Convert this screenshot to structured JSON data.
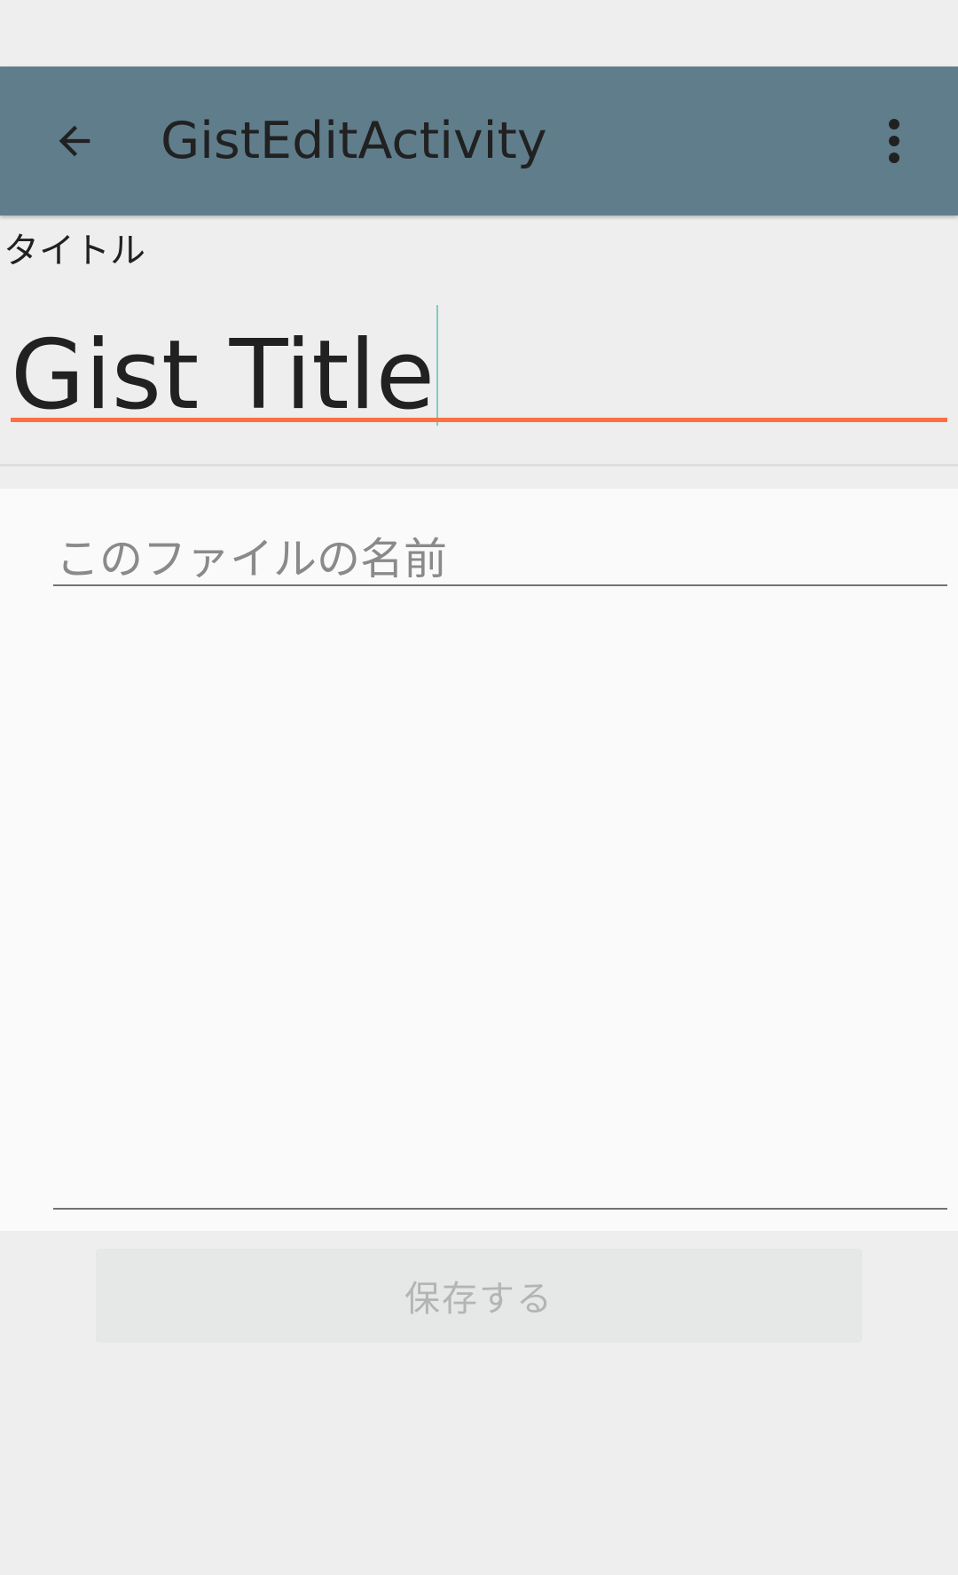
{
  "toolbar": {
    "title": "GistEditActivity",
    "back_icon": "arrow-back-icon",
    "overflow_icon": "more-vert-icon",
    "background_color": "#607d8b"
  },
  "form": {
    "title_label": "タイトル",
    "title_value": "Gist Title",
    "title_accent_color": "#ff7043",
    "filename_placeholder": "このファイルの名前",
    "content_value": ""
  },
  "save_button": {
    "label": "保存する"
  }
}
